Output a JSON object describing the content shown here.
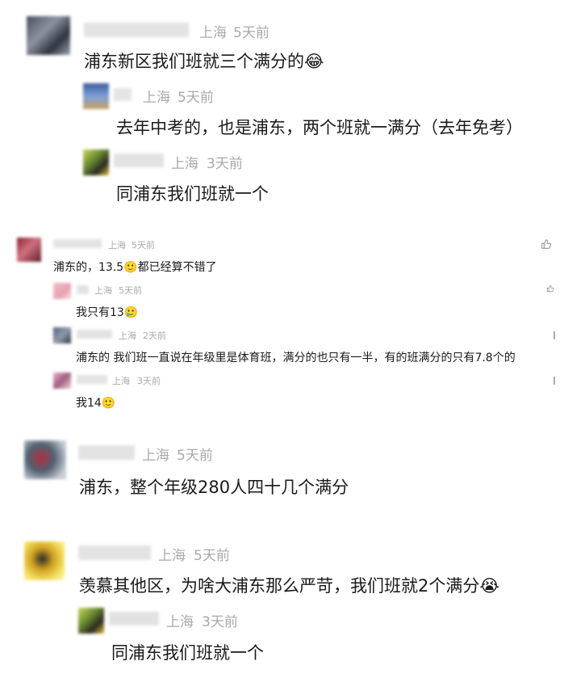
{
  "comments": [
    {
      "location": "上海",
      "time": "5天前",
      "text": "浦东新区我们班就三个满分的😂"
    },
    {
      "location": "上海",
      "time": "5天前",
      "text": "去年中考的，也是浦东，两个班就一满分（去年免考）"
    },
    {
      "location": "上海",
      "time": "3天前",
      "text": "同浦东我们班就一个"
    },
    {
      "location": "上海",
      "time": "5天前",
      "text": "浦东的，13.5🙂都已经算不错了"
    },
    {
      "location": "上海",
      "time": "5天前",
      "text": "我只有13🥲"
    },
    {
      "location": "上海",
      "time": "2天前",
      "text": "浦东的 我们班一直说在年级里是体育班，满分的也只有一半，有的班满分的只有7.8个的"
    },
    {
      "location": "上海",
      "time": "3天前",
      "text": "我14🙂"
    },
    {
      "location": "上海",
      "time": "5天前",
      "text": "浦东，整个年级280人四十几个满分"
    },
    {
      "location": "上海",
      "time": "5天前",
      "text": "羡慕其他区，为啥大浦东那么严苛，我们班就2个满分😭"
    },
    {
      "location": "上海",
      "time": "3天前",
      "text": "同浦东我们班就一个"
    }
  ],
  "icons": {
    "like": "thumbs-up-icon"
  }
}
